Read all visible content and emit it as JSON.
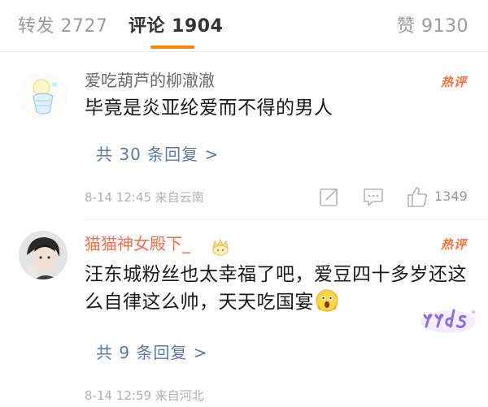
{
  "tabs": {
    "repost": "转发 2727",
    "comments": "评论 1904",
    "likes": "赞 9130"
  },
  "comments": [
    {
      "username": "爱吃葫芦的柳澈澈",
      "hot_label": "热评",
      "text": "毕竟是炎亚纶爱而不得的男人",
      "replies": "共 30 条回复 >",
      "meta": "8-14 12:45  来自云南",
      "likes": "1349",
      "icons": [
        "share-icon",
        "comment-icon",
        "like-icon"
      ]
    },
    {
      "username": "猫猫神女殿下_",
      "hot_label": "热评",
      "text": "汪东城粉丝也太幸福了吧，爱豆四十多岁还这么自律这么帅，天天吃国宴",
      "replies": "共 9 条回复 >",
      "meta": "8-14 12:59  来自河北"
    }
  ],
  "colors": {
    "accent": "#ff8200",
    "username_highlight": "#eb7350",
    "reply_link": "#5b7aa8",
    "hot_tag": "#ff6f3c"
  }
}
